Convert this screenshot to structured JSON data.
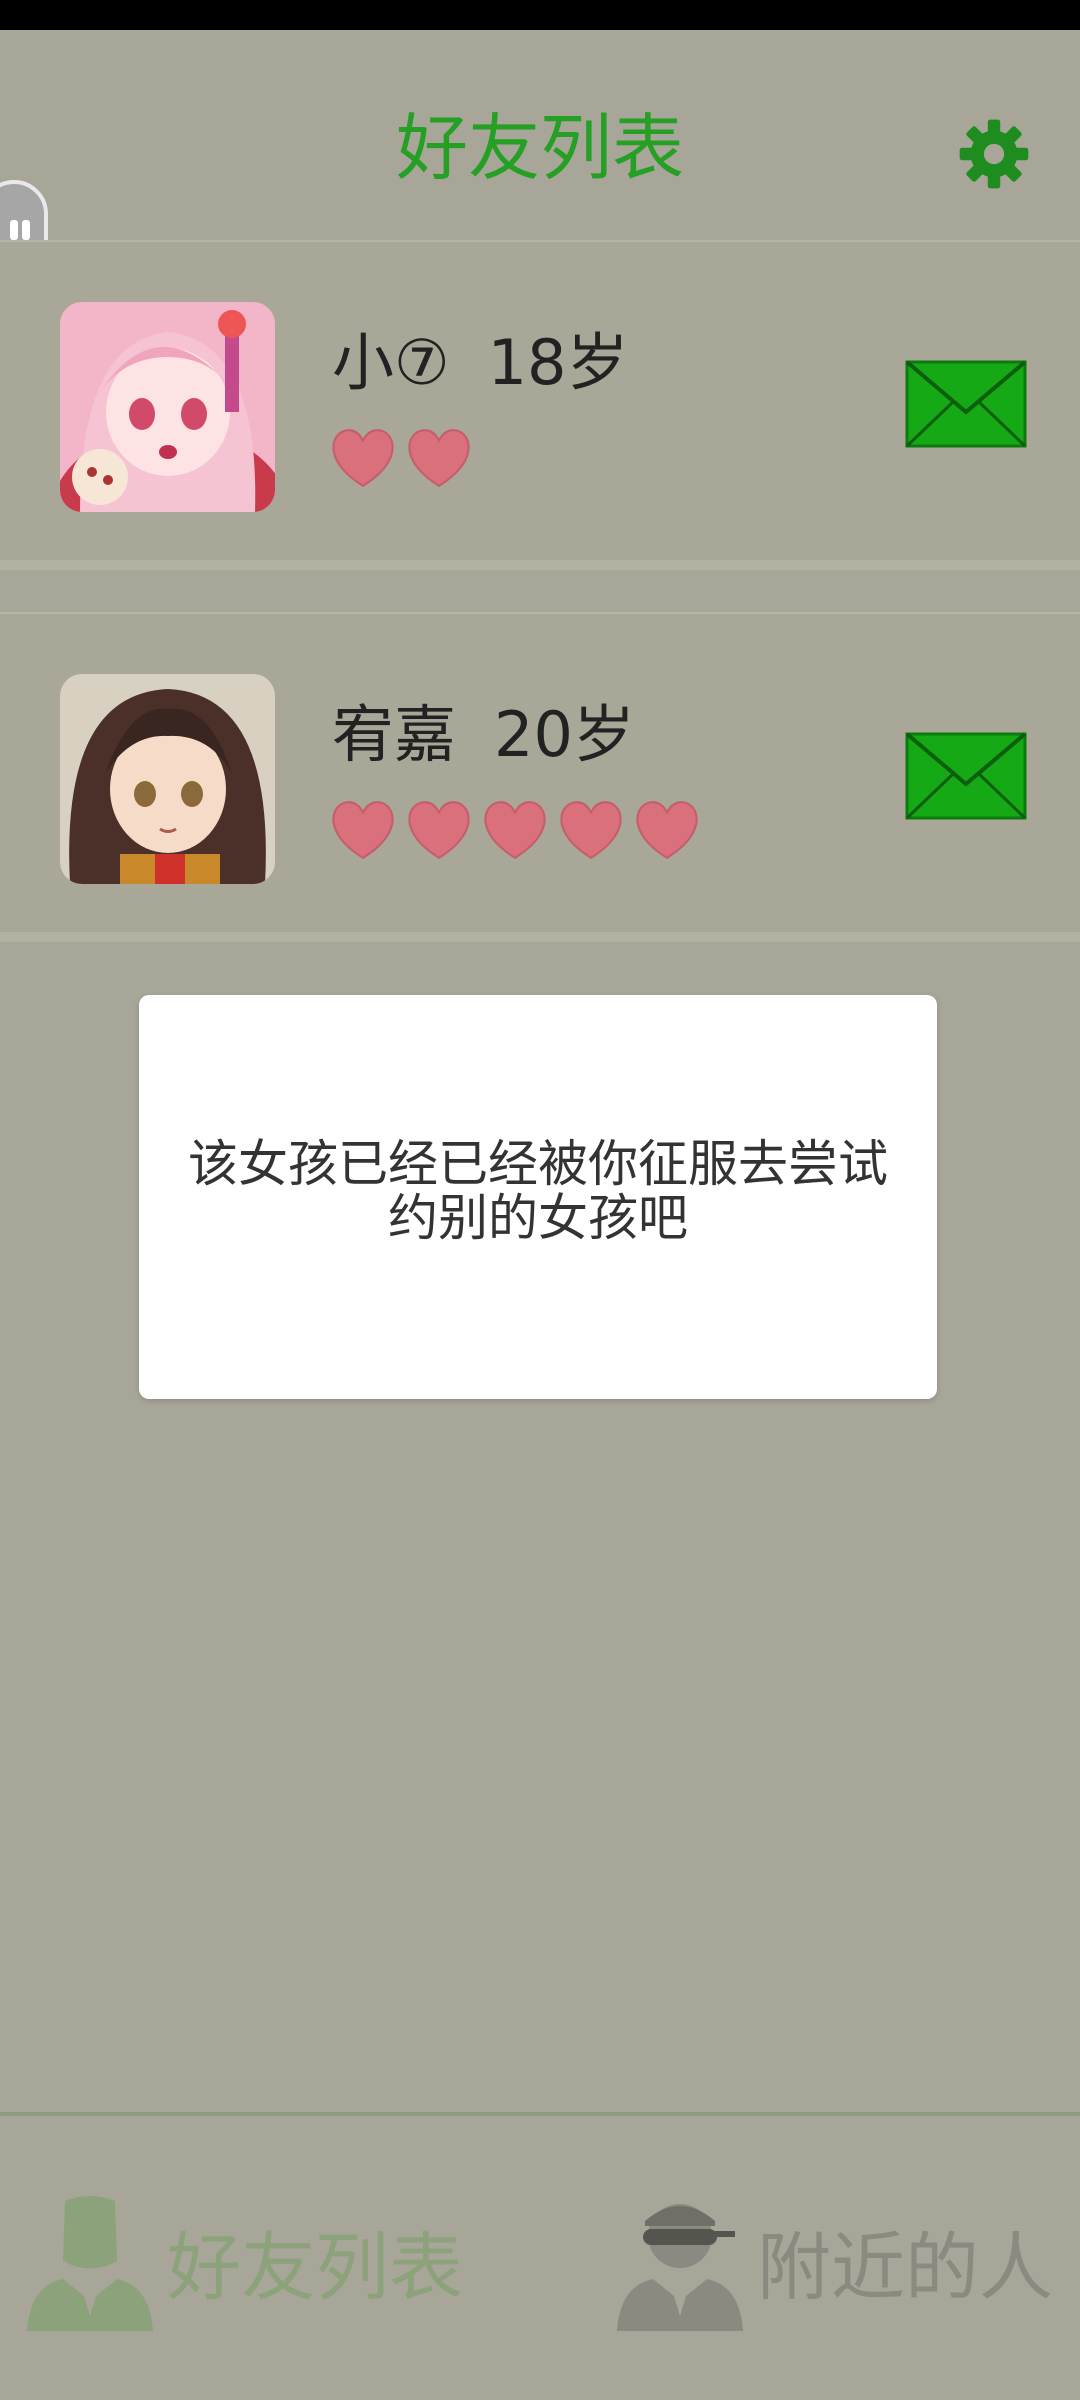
{
  "header": {
    "title": "好友列表"
  },
  "friends": [
    {
      "name": "小⑦",
      "age": "18岁",
      "hearts": 2
    },
    {
      "name": "宥嘉",
      "age": "20岁",
      "hearts": 5
    }
  ],
  "dialog": {
    "message": "该女孩已经已经被你征服去尝试约别的女孩吧"
  },
  "bottom_nav": {
    "friends_label": "好友列表",
    "nearby_label": "附近的人"
  },
  "colors": {
    "accent": "#25a025",
    "mail": "#15a915",
    "heart": "#d9707c",
    "background": "#a8a698"
  },
  "icons": [
    "gear-icon",
    "mail-icon",
    "heart-icon",
    "person-icon",
    "masked-person-icon",
    "assistant-bubble-icon"
  ]
}
